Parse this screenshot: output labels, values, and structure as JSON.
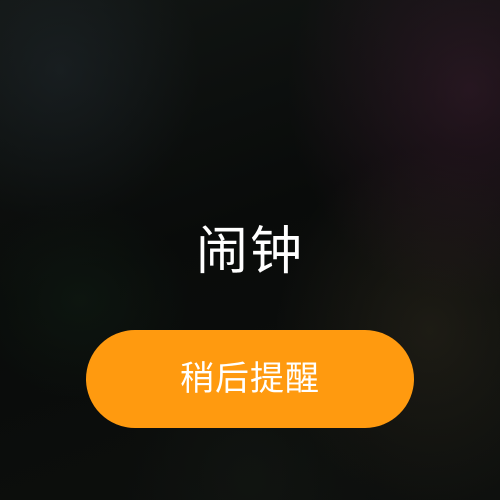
{
  "alarm": {
    "title": "闹钟",
    "snooze_label": "稍后提醒"
  },
  "colors": {
    "snooze_button": "#ff9a0f",
    "text": "#ffffff"
  }
}
